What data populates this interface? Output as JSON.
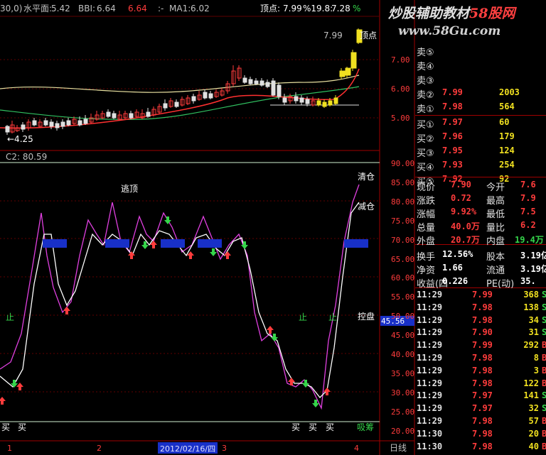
{
  "header": {
    "period": "30,0)",
    "horizon_label": "水平面:",
    "horizon_value": "5.42",
    "bbi_label": "BBI:",
    "bbi_value": "6.64",
    "bbi2_value": "6.64",
    "sep": ":-",
    "ma1_label": "MA1:",
    "ma1_value": "6.02",
    "top_label": "顶点:",
    "top_value": "7.99",
    "pct_label": "%19.8:",
    "pct_value": "7.28",
    "pct_sign": "%"
  },
  "watermark": {
    "line1": "炒股辅助教材",
    "brand": "58股网",
    "url": "www.58Gu.com"
  },
  "main_chart": {
    "price_axis": [
      "7.00",
      "6.00",
      "5.00"
    ],
    "peak_price": "7.99",
    "peak_label": "顶点",
    "low_label": "←4.25"
  },
  "indicator": {
    "title": "C2: 80.59",
    "axis": [
      "90.00",
      "85.00",
      "80.00",
      "75.00",
      "70.00",
      "65.00",
      "60.00",
      "55.00",
      "50.00",
      "45.00",
      "40.00",
      "35.00",
      "30.00",
      "25.00",
      "20.00"
    ],
    "current_value": "45.56",
    "labels": {
      "escape": "逃顶",
      "clear": "清仓",
      "reduce": "减仓",
      "control": "控盘",
      "absorb": "吸筹",
      "stop1": "止",
      "stop2": "止",
      "stop3": "止",
      "buy": "买"
    }
  },
  "date_bar": {
    "marks": [
      "1",
      "2",
      "3",
      "4"
    ],
    "date": "2012/02/16/四",
    "period_label": "日线"
  },
  "order_book": {
    "sells": [
      {
        "label": "卖⑤",
        "price": "",
        "vol": ""
      },
      {
        "label": "卖④",
        "price": "",
        "vol": ""
      },
      {
        "label": "卖③",
        "price": "",
        "vol": ""
      },
      {
        "label": "卖②",
        "price": "7.99",
        "vol": "2003"
      },
      {
        "label": "卖①",
        "price": "7.98",
        "vol": "564"
      }
    ],
    "buys": [
      {
        "label": "买①",
        "price": "7.97",
        "vol": "60"
      },
      {
        "label": "买②",
        "price": "7.96",
        "vol": "179"
      },
      {
        "label": "买③",
        "price": "7.95",
        "vol": "124"
      },
      {
        "label": "买④",
        "price": "7.93",
        "vol": "254"
      },
      {
        "label": "买⑤",
        "price": "7.92",
        "vol": "92"
      }
    ]
  },
  "quote": [
    {
      "l1": "现价",
      "v1": "7.90",
      "l2": "今开",
      "v2": "7.6"
    },
    {
      "l1": "涨跌",
      "v1": "0.72",
      "l2": "最高",
      "v2": "7.9"
    },
    {
      "l1": "涨幅",
      "v1": "9.92%",
      "l2": "最低",
      "v2": "7.5"
    },
    {
      "l1": "总量",
      "v1": "40.0万",
      "l2": "量比",
      "v2": "6.2"
    },
    {
      "l1": "外盘",
      "v1": "20.7万",
      "l2": "内盘",
      "v2": "19.4万"
    },
    {
      "l1": "换手",
      "v1": "12.56%",
      "l2": "股本",
      "v2": "3.19亿"
    },
    {
      "l1": "净资",
      "v1": "1.66",
      "l2": "流通",
      "v2": "3.19亿"
    },
    {
      "l1": "收益(四",
      "v1": "0.226",
      "l2": "PE(动)",
      "v2": "35."
    }
  ],
  "ticks": [
    {
      "time": "11:29",
      "price": "7.99",
      "vol": "368",
      "flag": "S"
    },
    {
      "time": "11:29",
      "price": "7.98",
      "vol": "138",
      "flag": "S"
    },
    {
      "time": "11:29",
      "price": "7.98",
      "vol": "34",
      "flag": "S"
    },
    {
      "time": "11:29",
      "price": "7.90",
      "vol": "31",
      "flag": "S"
    },
    {
      "time": "11:29",
      "price": "7.99",
      "vol": "292",
      "flag": "B"
    },
    {
      "time": "11:29",
      "price": "7.98",
      "vol": "8",
      "flag": "B"
    },
    {
      "time": "11:29",
      "price": "7.98",
      "vol": "3",
      "flag": "B"
    },
    {
      "time": "11:29",
      "price": "7.98",
      "vol": "122",
      "flag": "B"
    },
    {
      "time": "11:29",
      "price": "7.97",
      "vol": "141",
      "flag": "S"
    },
    {
      "time": "11:29",
      "price": "7.97",
      "vol": "32",
      "flag": "S"
    },
    {
      "time": "11:29",
      "price": "7.98",
      "vol": "57",
      "flag": "B"
    },
    {
      "time": "11:30",
      "price": "7.98",
      "vol": "20",
      "flag": "B"
    },
    {
      "time": "11:30",
      "price": "7.98",
      "vol": "40",
      "flag": "B"
    }
  ]
}
